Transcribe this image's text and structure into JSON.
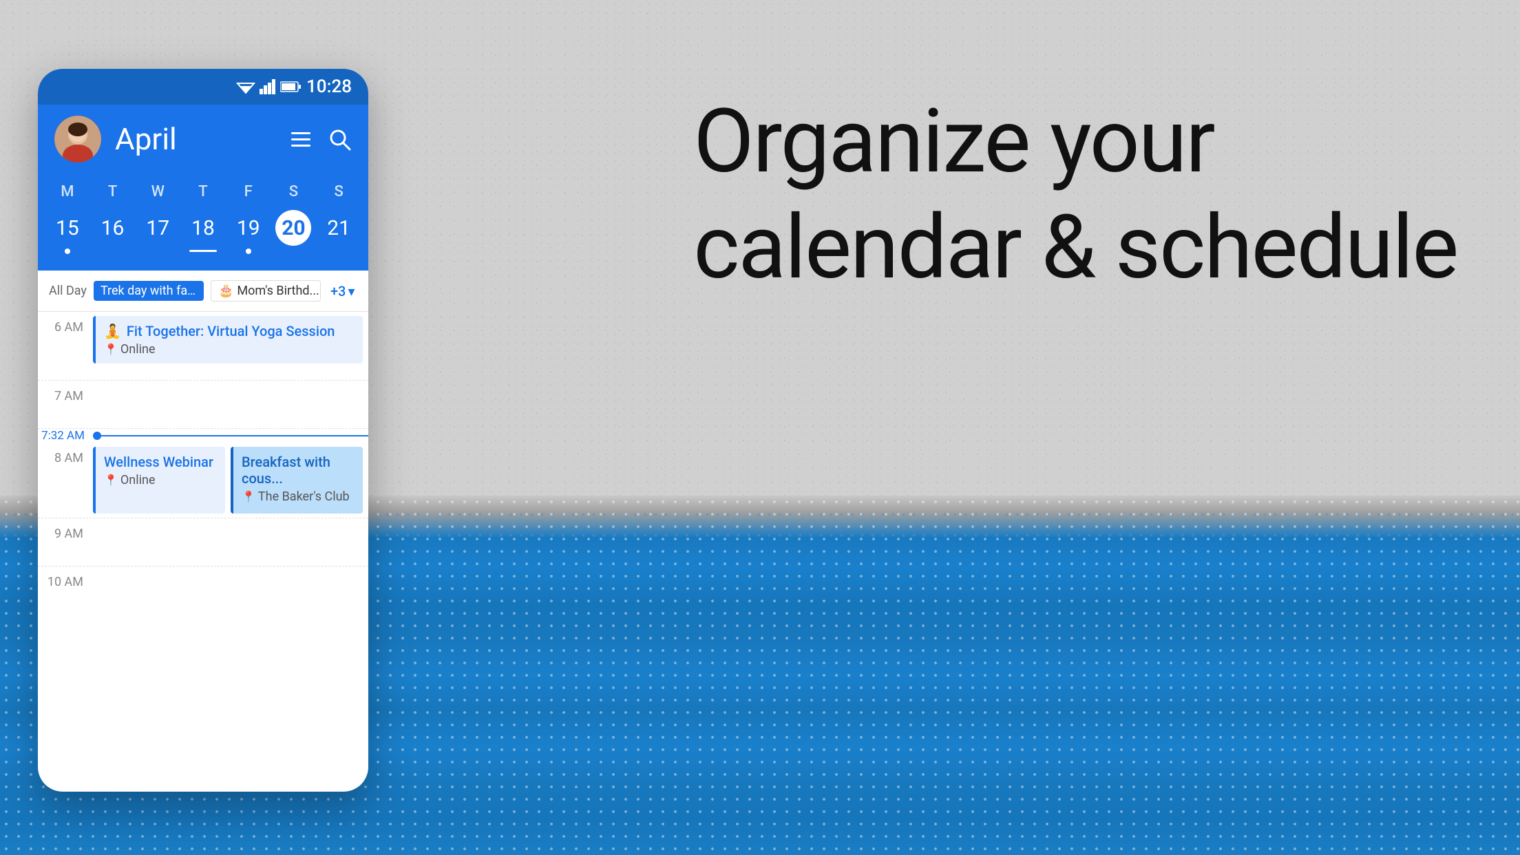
{
  "background": {
    "color_top": "#d0d0d0",
    "color_blue": "#1a7dc4"
  },
  "headline": {
    "line1": "Organize your",
    "line2": "calendar & schedule"
  },
  "phone": {
    "status_bar": {
      "time": "10:28"
    },
    "header": {
      "month": "April",
      "list_icon": "☰",
      "search_icon": "🔍"
    },
    "calendar": {
      "day_headers": [
        "M",
        "T",
        "W",
        "T",
        "F",
        "S",
        "S"
      ],
      "days": [
        {
          "num": "15",
          "dot": true,
          "selected": false,
          "underline": false
        },
        {
          "num": "16",
          "dot": false,
          "selected": false,
          "underline": false
        },
        {
          "num": "17",
          "dot": false,
          "selected": false,
          "underline": false
        },
        {
          "num": "18",
          "dot": false,
          "selected": false,
          "underline": true
        },
        {
          "num": "19",
          "dot": true,
          "selected": false,
          "underline": false
        },
        {
          "num": "20",
          "dot": false,
          "selected": true,
          "underline": false
        },
        {
          "num": "21",
          "dot": false,
          "selected": false,
          "underline": false
        }
      ]
    },
    "allday": {
      "label": "All Day",
      "events": [
        {
          "text": "Trek day with fa...",
          "type": "blue"
        },
        {
          "text": "Mom's Birthd...",
          "type": "birthday"
        },
        {
          "more": "+3"
        }
      ]
    },
    "schedule": {
      "slots": [
        {
          "time": "6 AM",
          "events": [
            {
              "title": "Fit Together: Virtual Yoga Session",
              "location": "Online",
              "icon": "yoga",
              "color": "light-blue"
            }
          ]
        },
        {
          "time": "7 AM",
          "events": []
        },
        {
          "time": "7:32 AM",
          "is_now": true
        },
        {
          "time": "8 AM",
          "events": [
            {
              "title": "Wellness Webinar",
              "location": "Online",
              "icon": "webinar",
              "color": "light-blue"
            },
            {
              "title": "Breakfast with cous...",
              "location": "The Baker's Club",
              "icon": "pin",
              "color": "dark-blue"
            }
          ]
        },
        {
          "time": "9 AM",
          "events": []
        },
        {
          "time": "10 AM",
          "events": []
        }
      ]
    }
  }
}
